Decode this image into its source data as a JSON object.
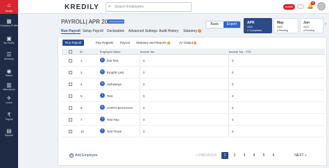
{
  "topbar": {
    "home_label": "Home",
    "logo": "KREDILY",
    "search_placeholder": "Search Employees",
    "admin_label": "Admin",
    "notification_count": "99"
  },
  "sidebar": {
    "items": [
      {
        "label": "Company Profile",
        "icon": "building-icon"
      },
      {
        "label": "My Profile",
        "icon": "profile-icon"
      },
      {
        "label": "Directory",
        "icon": "directory-icon"
      },
      {
        "label": "Reach",
        "icon": "reach-icon"
      },
      {
        "label": "Attendance",
        "icon": "attendance-icon"
      },
      {
        "label": "Leave",
        "icon": "leave-icon"
      },
      {
        "label": "Payroll",
        "icon": "payroll-icon"
      },
      {
        "label": "Reports",
        "icon": "reports-icon"
      }
    ]
  },
  "header": {
    "title": "PAYROLL| APR 2023",
    "tag": "Viewing Payroll",
    "mode_basic": "Basic",
    "mode_expert": "Expert"
  },
  "months": [
    {
      "name": "APR",
      "year": "2023",
      "status": "Completed"
    },
    {
      "name": "May",
      "year": "2023",
      "status": "Pending"
    },
    {
      "name": "Jun",
      "year": "2023",
      "status": "Pending"
    }
  ],
  "tabs": [
    {
      "label": "Run Payroll"
    },
    {
      "label": "Setup Payroll"
    },
    {
      "label": "Declaration"
    },
    {
      "label": "Advanced Settings"
    },
    {
      "label": "Audit History"
    },
    {
      "label": "Statutory",
      "count": "2"
    }
  ],
  "subtabs": [
    {
      "label": "Run Payroll"
    },
    {
      "label": "Pay Register"
    },
    {
      "label": "Payout"
    },
    {
      "label": "Statutory and Reports",
      "count": "2"
    },
    {
      "label": "JV Output",
      "count": "2"
    }
  ],
  "table": {
    "headers": [
      "ID",
      "Employee Name",
      "Income Tax",
      "Income Tax - YTD"
    ],
    "rows": [
      {
        "id": "1",
        "initial": "E",
        "name": "EW Test",
        "income_tax": "0",
        "income_tax_ytd": "0"
      },
      {
        "id": "2",
        "initial": "E",
        "name": "Emp05 Last",
        "income_tax": "0",
        "income_tax_ytd": "0"
      },
      {
        "id": "4",
        "initial": "A",
        "name": "Aishwarya",
        "income_tax": "0",
        "income_tax_ytd": "0"
      },
      {
        "id": "5",
        "initial": "T",
        "name": "Test",
        "income_tax": "0",
        "income_tax_ytd": "0"
      },
      {
        "id": "6",
        "initial": "A",
        "name": "AARYA BACHHAV",
        "income_tax": "0",
        "income_tax_ytd": "0"
      },
      {
        "id": "7",
        "initial": "T",
        "name": "Test Two",
        "income_tax": "0",
        "income_tax_ytd": "0"
      },
      {
        "id": "10",
        "initial": "T",
        "name": "Test Three",
        "income_tax": "0",
        "income_tax_ytd": "0"
      }
    ]
  },
  "footer": {
    "add_employee": "Add Employee",
    "prev": "« PREVIOUS",
    "pages": [
      "1",
      "2",
      "3",
      "4",
      "5",
      "6"
    ],
    "current_page": "1",
    "next": "NEXT »"
  },
  "colors": {
    "brand_red": "#d7262f",
    "sidebar_navy": "#1f2a44",
    "primary_blue": "#2a4c8b",
    "accent_blue": "#2f66d0"
  }
}
